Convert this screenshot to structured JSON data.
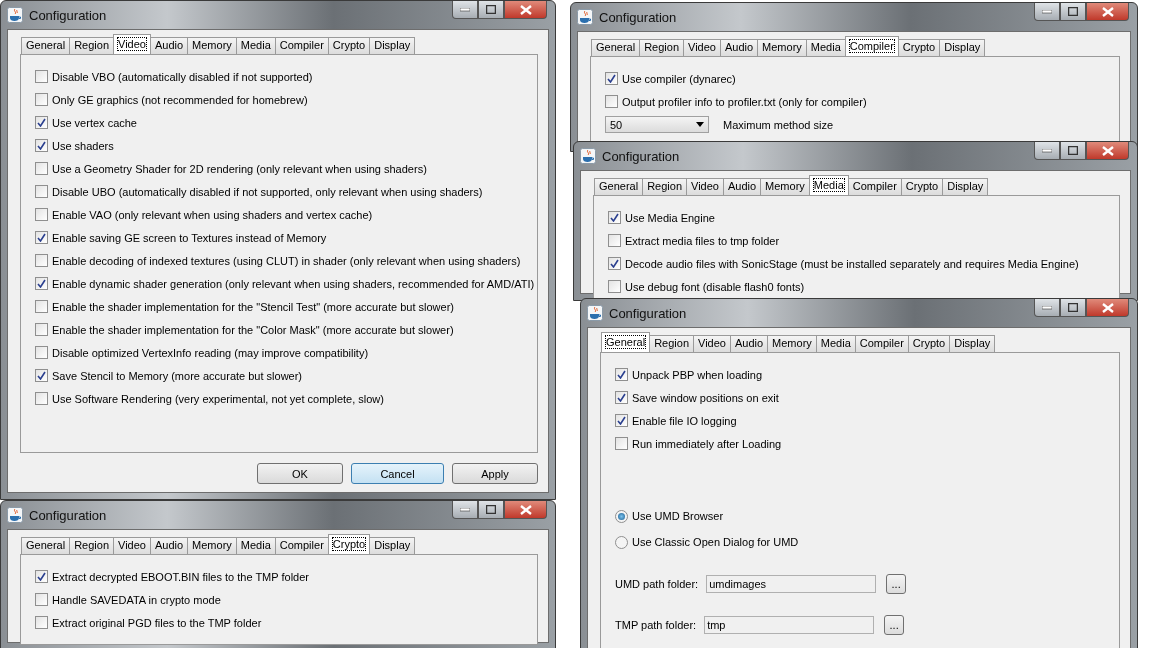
{
  "windows": [
    {
      "title": "Configuration",
      "tabs": [
        {
          "label": "General",
          "selected": false
        },
        {
          "label": "Region",
          "selected": false
        },
        {
          "label": "Video",
          "selected": true
        },
        {
          "label": "Audio",
          "selected": false
        },
        {
          "label": "Memory",
          "selected": false
        },
        {
          "label": "Media",
          "selected": false
        },
        {
          "label": "Compiler",
          "selected": false
        },
        {
          "label": "Crypto",
          "selected": false
        },
        {
          "label": "Display",
          "selected": false
        }
      ],
      "options": [
        {
          "kind": "checkbox",
          "label": "Disable VBO (automatically disabled if not supported)",
          "checked": false
        },
        {
          "kind": "checkbox",
          "label": "Only GE graphics (not recommended for homebrew)",
          "checked": false
        },
        {
          "kind": "checkbox",
          "label": "Use vertex cache",
          "checked": true
        },
        {
          "kind": "checkbox",
          "label": "Use shaders",
          "checked": true
        },
        {
          "kind": "checkbox",
          "label": "Use a Geometry Shader for 2D rendering (only relevant when using shaders)",
          "checked": false
        },
        {
          "kind": "checkbox",
          "label": "Disable UBO (automatically disabled if not supported, only relevant when using shaders)",
          "checked": false
        },
        {
          "kind": "checkbox",
          "label": "Enable VAO (only relevant when using shaders and vertex cache)",
          "checked": false
        },
        {
          "kind": "checkbox",
          "label": "Enable saving GE screen to Textures instead of Memory",
          "checked": true
        },
        {
          "kind": "checkbox",
          "label": "Enable decoding of indexed textures (using CLUT) in shader (only relevant when using shaders)",
          "checked": false
        },
        {
          "kind": "checkbox",
          "label": "Enable dynamic shader generation (only relevant when using shaders, recommended for AMD/ATI)",
          "checked": true
        },
        {
          "kind": "checkbox",
          "label": "Enable the shader implementation for the \"Stencil Test\" (more accurate but slower)",
          "checked": false
        },
        {
          "kind": "checkbox",
          "label": "Enable the shader implementation for the \"Color Mask\" (more accurate but slower)",
          "checked": false
        },
        {
          "kind": "checkbox",
          "label": "Disable optimized VertexInfo reading (may improve compatibility)",
          "checked": false
        },
        {
          "kind": "checkbox",
          "label": "Save Stencil to Memory (more accurate but slower)",
          "checked": true
        },
        {
          "kind": "checkbox",
          "label": "Use Software Rendering (very experimental, not yet complete, slow)",
          "checked": false
        }
      ],
      "buttons": [
        {
          "label": "OK",
          "default": false
        },
        {
          "label": "Cancel",
          "default": true
        },
        {
          "label": "Apply",
          "default": false
        }
      ]
    },
    {
      "title": "Configuration",
      "tabs": [
        {
          "label": "General",
          "selected": false
        },
        {
          "label": "Region",
          "selected": false
        },
        {
          "label": "Video",
          "selected": false
        },
        {
          "label": "Audio",
          "selected": false
        },
        {
          "label": "Memory",
          "selected": false
        },
        {
          "label": "Media",
          "selected": false
        },
        {
          "label": "Compiler",
          "selected": false
        },
        {
          "label": "Crypto",
          "selected": true
        },
        {
          "label": "Display",
          "selected": false
        }
      ],
      "options": [
        {
          "kind": "checkbox",
          "label": "Extract decrypted EBOOT.BIN files to the TMP folder",
          "checked": true
        },
        {
          "kind": "checkbox",
          "label": "Handle SAVEDATA in crypto mode",
          "checked": false
        },
        {
          "kind": "checkbox",
          "label": "Extract original PGD files to the TMP folder",
          "checked": false
        }
      ]
    },
    {
      "title": "Configuration",
      "tabs": [
        {
          "label": "General",
          "selected": false
        },
        {
          "label": "Region",
          "selected": false
        },
        {
          "label": "Video",
          "selected": false
        },
        {
          "label": "Audio",
          "selected": false
        },
        {
          "label": "Memory",
          "selected": false
        },
        {
          "label": "Media",
          "selected": false
        },
        {
          "label": "Compiler",
          "selected": true
        },
        {
          "label": "Crypto",
          "selected": false
        },
        {
          "label": "Display",
          "selected": false
        }
      ],
      "options": [
        {
          "kind": "checkbox",
          "label": "Use compiler (dynarec)",
          "checked": true
        },
        {
          "kind": "checkbox",
          "label": "Output profiler info to profiler.txt (only for compiler)",
          "checked": false
        },
        {
          "kind": "combo",
          "value": "50",
          "caption": "Maximum method size"
        }
      ]
    },
    {
      "title": "Configuration",
      "tabs": [
        {
          "label": "General",
          "selected": false
        },
        {
          "label": "Region",
          "selected": false
        },
        {
          "label": "Video",
          "selected": false
        },
        {
          "label": "Audio",
          "selected": false
        },
        {
          "label": "Memory",
          "selected": false
        },
        {
          "label": "Media",
          "selected": true
        },
        {
          "label": "Compiler",
          "selected": false
        },
        {
          "label": "Crypto",
          "selected": false
        },
        {
          "label": "Display",
          "selected": false
        }
      ],
      "options": [
        {
          "kind": "checkbox",
          "label": "Use Media Engine",
          "checked": true
        },
        {
          "kind": "checkbox",
          "label": "Extract media files to tmp folder",
          "checked": false
        },
        {
          "kind": "checkbox",
          "label": "Decode audio files with SonicStage (must be installed separately and requires Media Engine)",
          "checked": true
        },
        {
          "kind": "checkbox",
          "label": "Use debug font (disable flash0 fonts)",
          "checked": false
        }
      ]
    },
    {
      "title": "Configuration",
      "tabs": [
        {
          "label": "General",
          "selected": true
        },
        {
          "label": "Region",
          "selected": false
        },
        {
          "label": "Video",
          "selected": false
        },
        {
          "label": "Audio",
          "selected": false
        },
        {
          "label": "Memory",
          "selected": false
        },
        {
          "label": "Media",
          "selected": false
        },
        {
          "label": "Compiler",
          "selected": false
        },
        {
          "label": "Crypto",
          "selected": false
        },
        {
          "label": "Display",
          "selected": false
        }
      ],
      "options": [
        {
          "kind": "checkbox",
          "label": "Unpack PBP when loading",
          "checked": true
        },
        {
          "kind": "checkbox",
          "label": "Save window positions on exit",
          "checked": true
        },
        {
          "kind": "checkbox",
          "label": "Enable file IO logging",
          "checked": true
        },
        {
          "kind": "checkbox",
          "label": "Run immediately after Loading",
          "checked": false
        },
        {
          "kind": "radio",
          "label": "Use UMD Browser",
          "selected": true
        },
        {
          "kind": "radio",
          "label": "Use Classic Open Dialog for UMD",
          "selected": false
        },
        {
          "kind": "path",
          "label": "UMD path folder:",
          "value": "umdimages",
          "button": "..."
        },
        {
          "kind": "path",
          "label": "TMP path folder:",
          "value": "tmp",
          "button": "..."
        }
      ]
    }
  ]
}
